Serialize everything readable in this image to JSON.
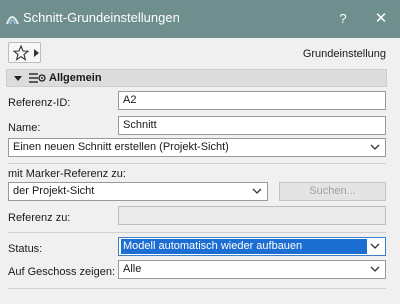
{
  "window": {
    "title": "Schnitt-Grundeinstellungen",
    "help_label": "?",
    "close_label": "✕"
  },
  "toolbar": {
    "favorites_icon": "star-icon",
    "preset_label": "Grundeinstellung"
  },
  "section": {
    "title": "Allgemein",
    "icon": "section-settings-icon"
  },
  "fields": {
    "reference_id": {
      "label": "Referenz-ID:",
      "value": "A2"
    },
    "name": {
      "label": "Name:",
      "value": "Schnitt"
    },
    "create_mode": {
      "value": "Einen neuen Schnitt erstellen (Projekt-Sicht)"
    },
    "marker_reference": {
      "label": "mit Marker-Referenz zu:",
      "value": "der Projekt-Sicht",
      "search_button": "Suchen..."
    },
    "reference_to": {
      "label": "Referenz zu:",
      "value": ""
    },
    "status": {
      "label": "Status:",
      "value": "Modell automatisch wieder aufbauen"
    },
    "show_on_story": {
      "label": "Auf Geschoss zeigen:",
      "value": "Alle"
    }
  },
  "colors": {
    "titlebar": "#6f8f8f",
    "selection": "#1c6ed2"
  }
}
